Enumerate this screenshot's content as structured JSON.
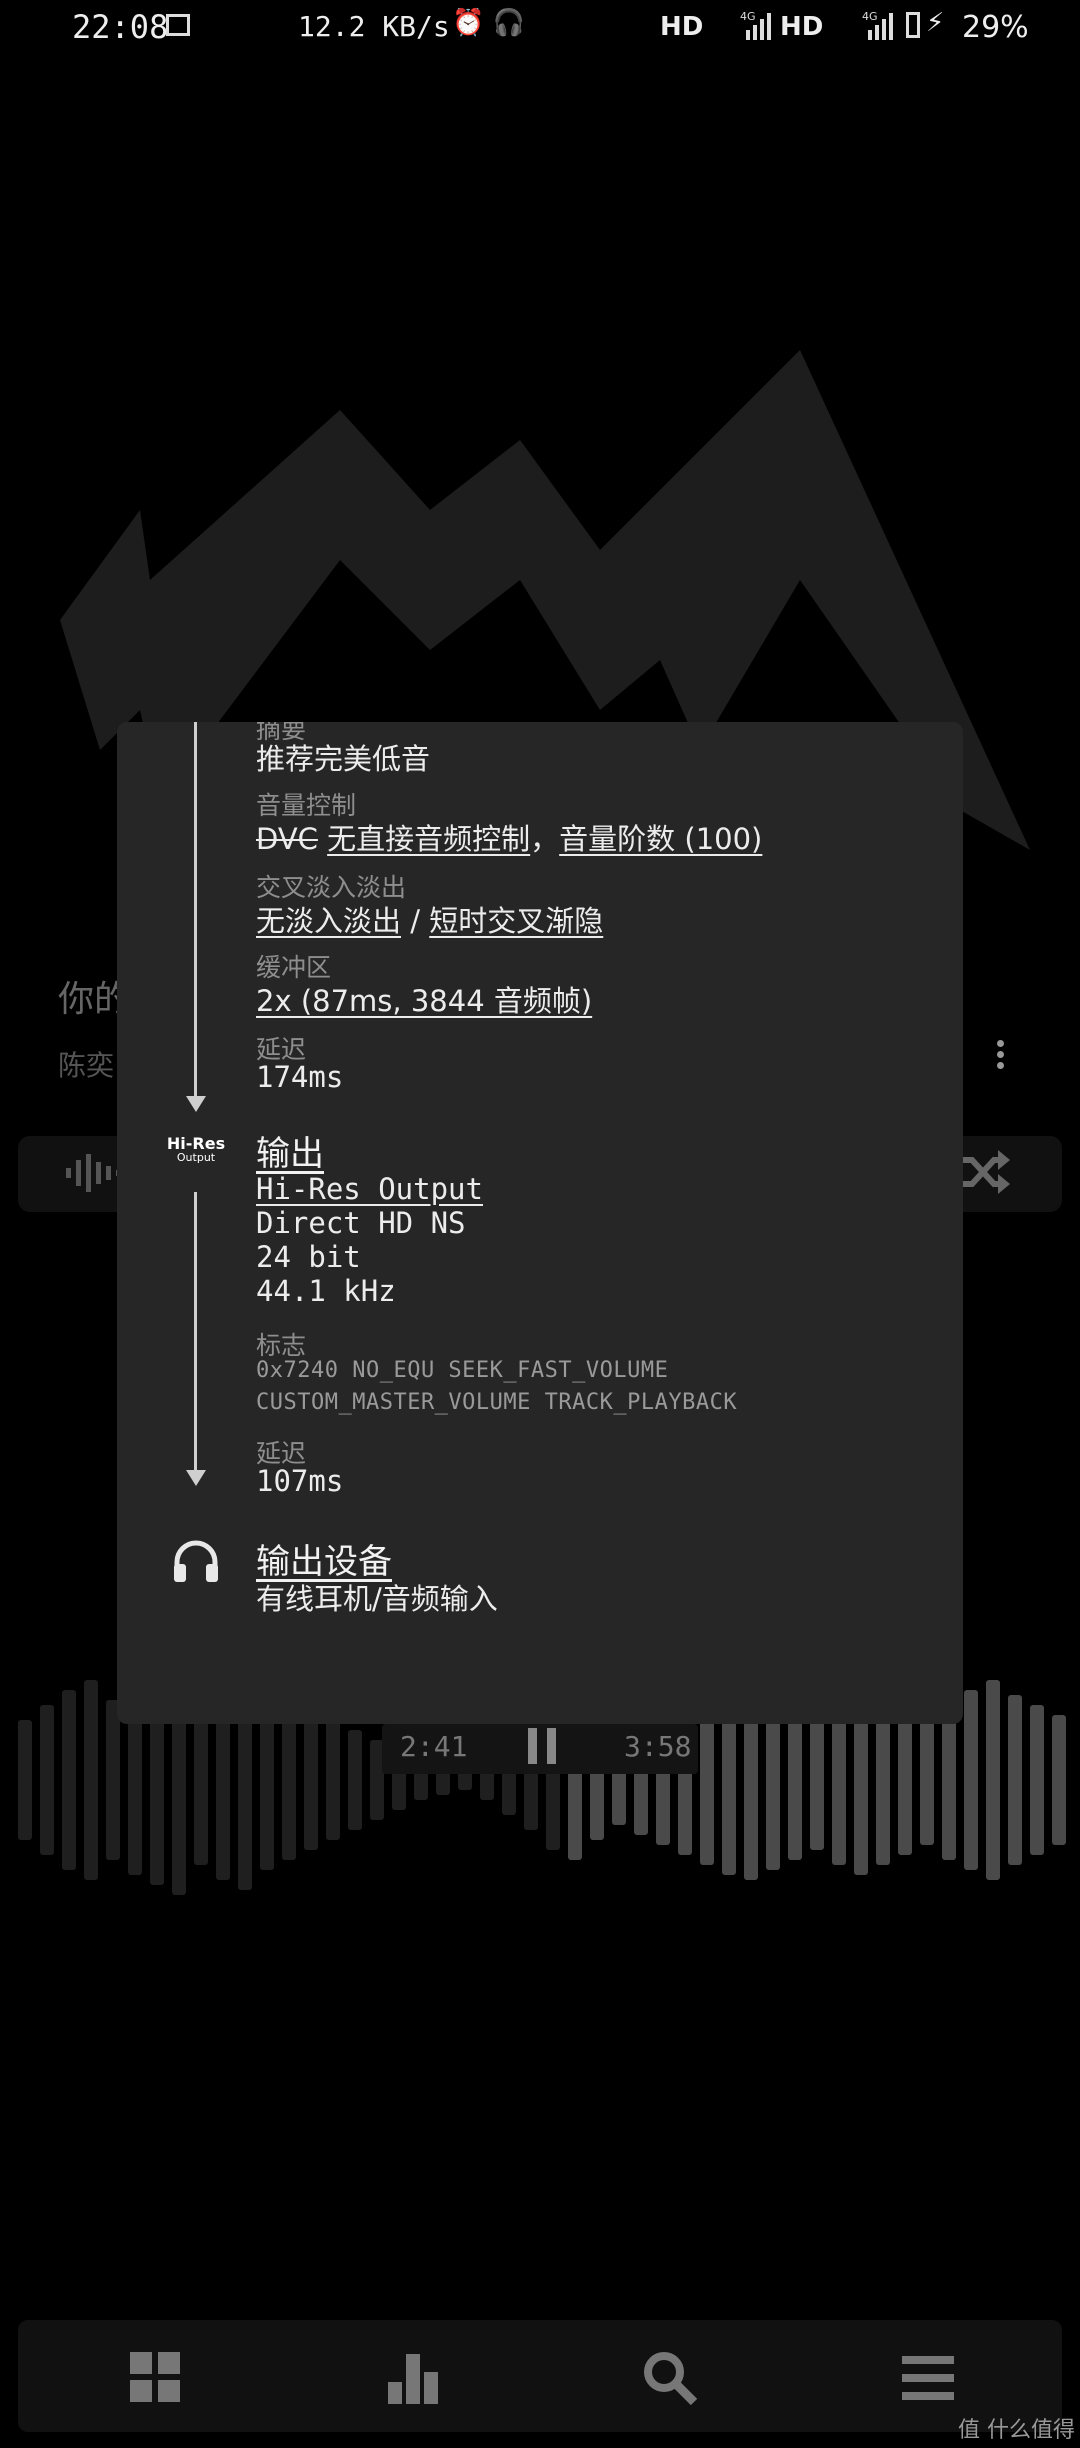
{
  "status_bar": {
    "time": "22:08",
    "speed": "12.2 KB/s",
    "icons": "⏰ 🎧",
    "hd1": "HD",
    "net1": "4G",
    "hd2": "HD",
    "net2": "4G",
    "battery": "29%"
  },
  "player": {
    "title_partial": "你的",
    "artist_partial": "陈奕",
    "current_time": "2:41",
    "total_time": "3:58"
  },
  "dialog": {
    "section1_label_partial": "摘要",
    "preset_value": "推荐完美低音",
    "volume_label": "音量控制",
    "volume_dvc": "DVC",
    "volume_value1": "无直接音频控制",
    "volume_sep": "，",
    "volume_value2": "音量阶数 (100)",
    "crossfade_label": "交叉淡入淡出",
    "crossfade_value1": "无淡入淡出",
    "crossfade_sep": " / ",
    "crossfade_value2": "短时交叉渐隐",
    "buffer_label": "缓冲区",
    "buffer_value": "2x (87ms, 3844 音频帧)",
    "latency_label1": "延迟",
    "latency_value1": "174ms",
    "hires_line1": "Hi-Res",
    "hires_line2": "Output",
    "output_heading": "输出",
    "output_name": "Hi-Res Output",
    "output_mode": "Direct HD NS",
    "output_bits": "24 bit",
    "output_rate": "44.1 kHz",
    "flags_label": "标志",
    "flags_line1": "0x7240 NO_EQU SEEK_FAST_VOLUME",
    "flags_line2": "CUSTOM_MASTER_VOLUME TRACK_PLAYBACK",
    "latency_label2": "延迟",
    "latency_value2": "107ms",
    "device_heading": "输出设备",
    "device_value": "有线耳机/音频输入"
  },
  "watermark": "值 什么值得买"
}
